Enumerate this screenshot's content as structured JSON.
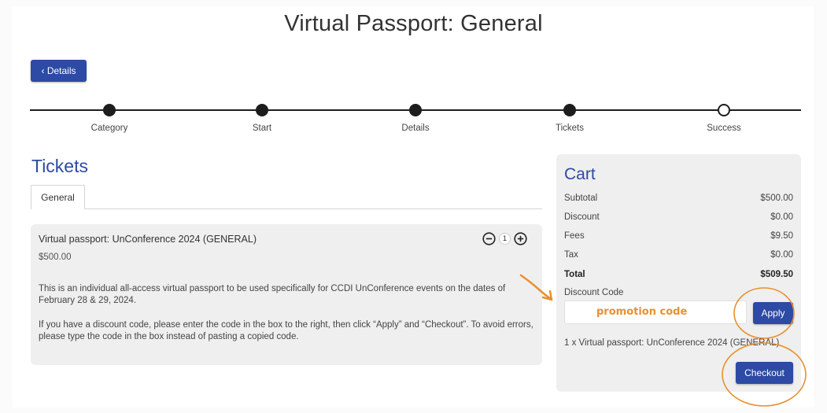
{
  "page": {
    "title": "Virtual Passport: General"
  },
  "nav": {
    "back_label": "‹ Details"
  },
  "stepper": {
    "steps": [
      {
        "label": "Category",
        "state": "complete"
      },
      {
        "label": "Start",
        "state": "complete"
      },
      {
        "label": "Details",
        "state": "complete"
      },
      {
        "label": "Tickets",
        "state": "complete"
      },
      {
        "label": "Success",
        "state": "pending"
      }
    ]
  },
  "tickets": {
    "heading": "Tickets",
    "tabs": [
      {
        "label": "General",
        "active": true
      }
    ],
    "item": {
      "name": "Virtual passport: UnConference 2024 (GENERAL)",
      "price": "$500.00",
      "quantity": "1",
      "description": "This is an individual all-access virtual passport to be used specifically for CCDI UnConference events on the dates of February 28 & 29, 2024.",
      "note": "If you have a discount code, please enter the code in the box to the right, then click “Apply” and “Checkout”. To avoid errors, please type the code in the box instead of pasting a copied code."
    }
  },
  "cart": {
    "heading": "Cart",
    "rows": [
      {
        "label": "Subtotal",
        "value": "$500.00"
      },
      {
        "label": "Discount",
        "value": "$0.00"
      },
      {
        "label": "Fees",
        "value": "$9.50"
      },
      {
        "label": "Tax",
        "value": "$0.00"
      }
    ],
    "total": {
      "label": "Total",
      "value": "$509.50"
    },
    "discount_label": "Discount Code",
    "discount_value": "",
    "apply_label": "Apply",
    "line_item": "1 x Virtual passport: UnConference 2024 (GENERAL)",
    "checkout_label": "Checkout"
  },
  "annotations": {
    "promo_note": "promotion code",
    "color": "#e8902e"
  },
  "colors": {
    "accent": "#2d4aa4",
    "panel": "#efefef",
    "annotation": "#e8902e"
  }
}
